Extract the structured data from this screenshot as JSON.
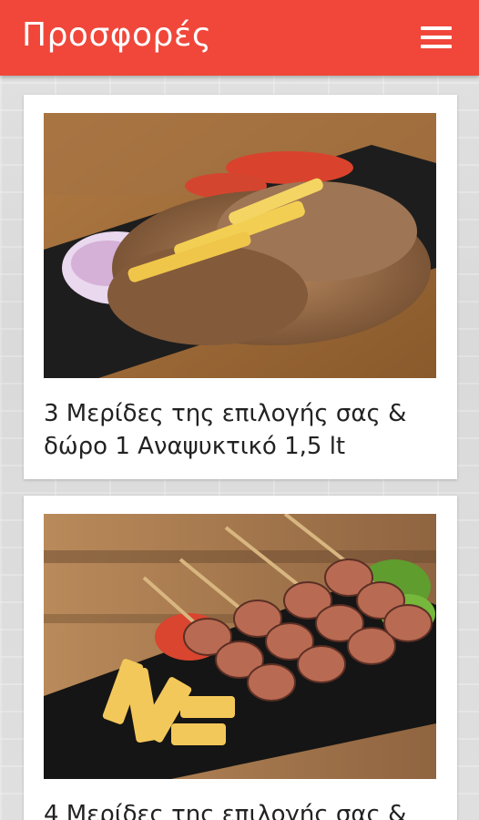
{
  "app_bar": {
    "title": "Προσφορές",
    "menu_icon": "hamburger-menu-icon"
  },
  "offers": [
    {
      "title": "3 Μερίδες της επιλογής σας & δώρο 1 Αναψυκτικό 1,5 lt",
      "image": "gyros-plate-photo"
    },
    {
      "title": "4 Μερίδες της επιλογής σας &",
      "image": "souvlaki-skewers-photo"
    }
  ],
  "colors": {
    "app_bar": "#f0473a",
    "card": "#ffffff",
    "text": "#222222"
  }
}
